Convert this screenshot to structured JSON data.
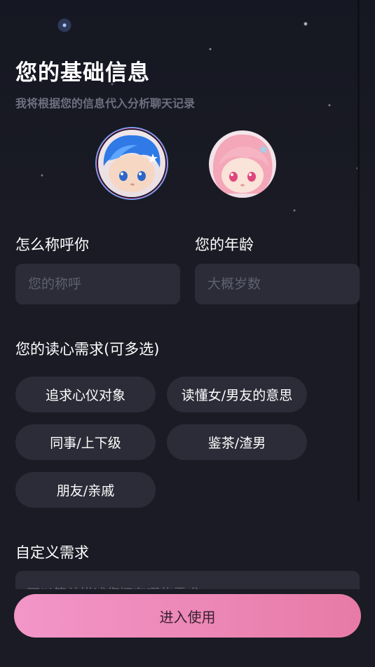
{
  "header": {
    "title": "您的基础信息",
    "subtitle": "我将根据您的信息代入分析聊天记录"
  },
  "avatars": [
    {
      "name": "male-avatar",
      "selected": true
    },
    {
      "name": "female-avatar",
      "selected": false
    }
  ],
  "form": {
    "nickname_label": "怎么称呼你",
    "nickname_placeholder": "您的称呼",
    "age_label": "您的年龄",
    "age_placeholder": "大概岁数"
  },
  "needs": {
    "label": "您的读心需求(可多选)",
    "options": [
      "追求心仪对象",
      "读懂女/男友的意思",
      "同事/上下级",
      "鉴茶/渣男",
      "朋友/亲戚"
    ]
  },
  "custom": {
    "label": "自定义需求",
    "placeholder": "可以简单描述您还有哪些需求"
  },
  "action": {
    "enter_label": "进入使用"
  },
  "colors": {
    "background": "#1a1b24",
    "field": "#2b2c37",
    "button_gradient_start": "#f296c8",
    "button_gradient_end": "#e77aa6"
  }
}
